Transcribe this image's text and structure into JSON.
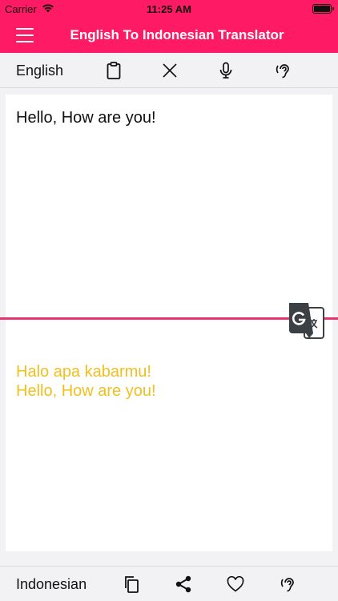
{
  "status_bar": {
    "carrier": "Carrier",
    "time": "11:25 AM",
    "battery_level": 1.0
  },
  "nav": {
    "title": "English To Indonesian Translator",
    "menu_icon": "hamburger-menu-icon"
  },
  "source": {
    "language": "English",
    "text": "Hello, How are you!",
    "icons": [
      "clipboard-icon",
      "close-icon",
      "microphone-icon",
      "ear-listen-icon"
    ]
  },
  "target": {
    "language": "Indonesian",
    "lines": [
      "Halo apa kabarmu!",
      "Hello, How are you!"
    ],
    "icons": [
      "copy-icon",
      "share-icon",
      "heart-icon",
      "ear-listen-icon"
    ]
  },
  "colors": {
    "brand": "#ff1a66",
    "divider": "#e8336e",
    "translation_text": "#f0c020",
    "translate_button": "#3a4043"
  }
}
